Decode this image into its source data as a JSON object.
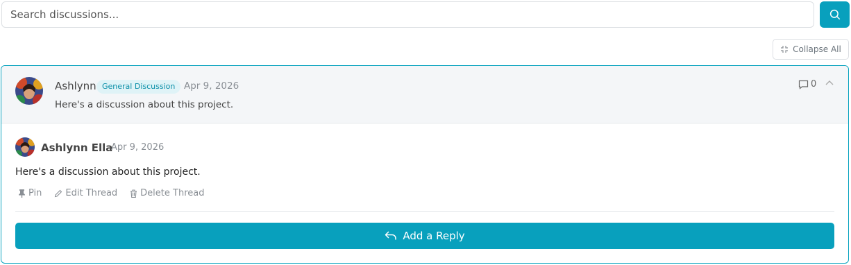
{
  "search": {
    "placeholder": "Search discussions..."
  },
  "toolbar": {
    "collapse_label": "Collapse All"
  },
  "thread": {
    "author": "Ashlynn",
    "category": "General Discussion",
    "date": "Apr 9, 2026",
    "preview": "Here's a discussion about this project.",
    "comment_count": "0",
    "post": {
      "author": "Ashlynn Ella",
      "date": "Apr 9, 2026",
      "body": "Here's a discussion about this project.",
      "actions": {
        "pin": "Pin",
        "edit": "Edit Thread",
        "delete": "Delete Thread"
      }
    },
    "reply_label": "Add a Reply"
  },
  "colors": {
    "accent": "#08a0bd",
    "badge_bg": "#dff3f7",
    "header_bg": "#f4f6f8"
  },
  "icons": [
    "search-icon",
    "collapse-icon",
    "avatar",
    "comment-icon",
    "chevron-up-icon",
    "pin-icon",
    "pencil-icon",
    "trash-icon",
    "reply-icon"
  ]
}
